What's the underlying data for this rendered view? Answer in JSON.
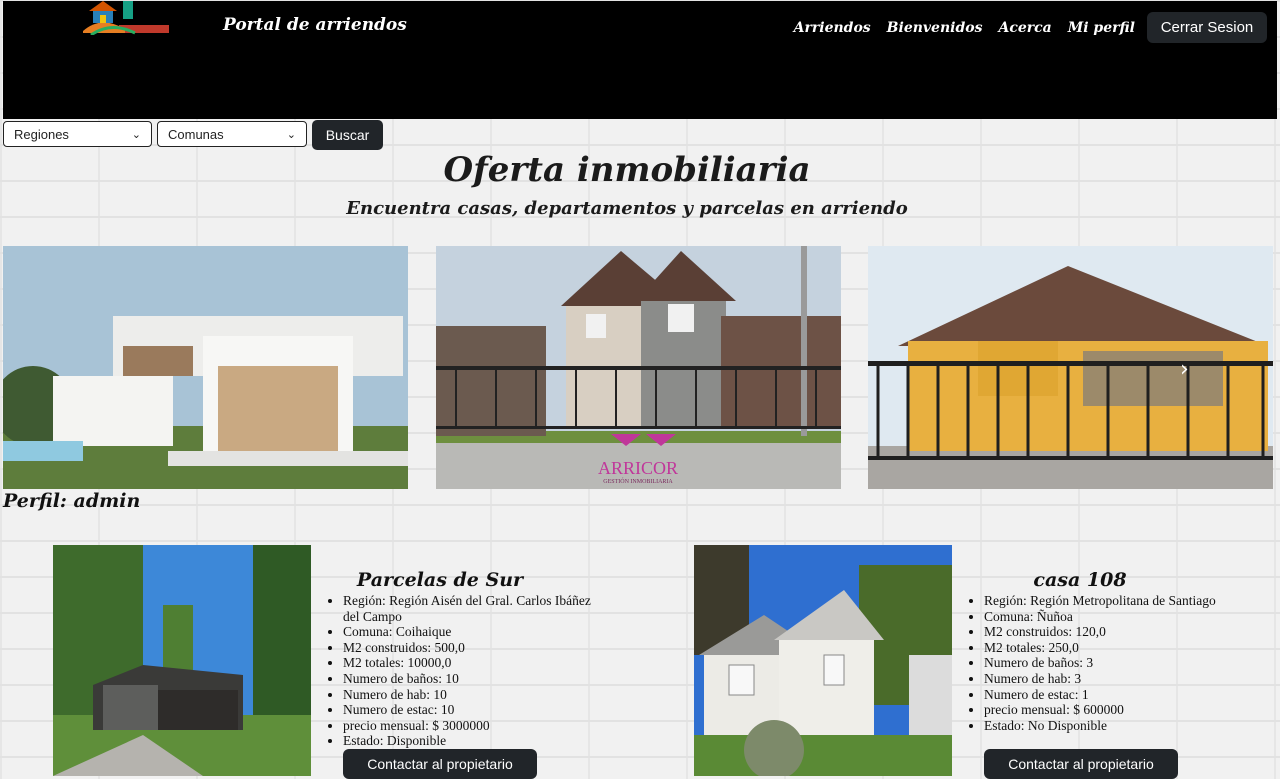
{
  "header": {
    "brand": "Portal de arriendos",
    "nav": [
      "Arriendos",
      "Bienvenidos",
      "Acerca",
      "Mi perfil"
    ],
    "logout_label": "Cerrar Sesion"
  },
  "filters": {
    "regions_label": "Regiones",
    "communes_label": "Comunas",
    "search_label": "Buscar"
  },
  "hero": {
    "title": "Oferta inmobiliaria",
    "subtitle": "Encuentra casas, departamentos y parcelas en arriendo",
    "watermark_brand": "ARRICOR",
    "watermark_sub": "GESTIÓN INMOBILIARIA"
  },
  "profile_label": "Perfil: admin",
  "listings": [
    {
      "title": "Parcelas de Sur",
      "details": [
        "Región: Región Aisén del Gral. Carlos Ibáñez del Campo",
        "Comuna: Coihaique",
        "M2 construidos: 500,0",
        "M2 totales: 10000,0",
        "Numero de baños: 10",
        "Numero de hab: 10",
        "Numero de estac: 10",
        "precio mensual: $ 3000000",
        "Estado: Disponible"
      ],
      "contact_label": "Contactar al propietario"
    },
    {
      "title": "casa 108",
      "details": [
        "Región: Región Metropolitana de Santiago",
        "Comuna: Ñuñoa",
        "M2 construidos: 120,0",
        "M2 totales: 250,0",
        "Numero de baños: 3",
        "Numero de hab: 3",
        "Numero de estac: 1",
        "precio mensual: $ 600000",
        "Estado: No Disponible"
      ],
      "contact_label": "Contactar al propietario"
    }
  ],
  "colors": {
    "topbar": "#000000",
    "button": "#212529",
    "accent_logo": "#c0392b"
  }
}
